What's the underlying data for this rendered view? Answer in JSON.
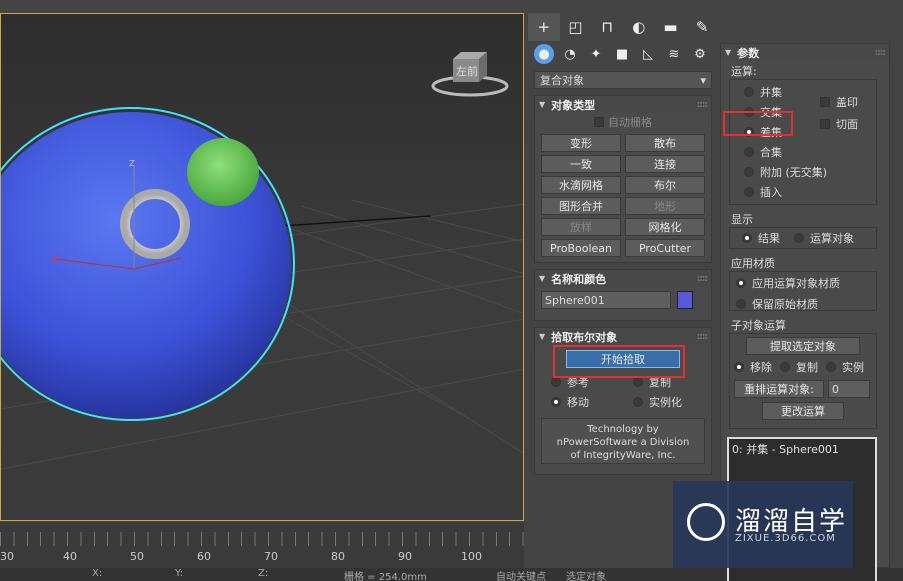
{
  "viewport": {
    "axis_labels": {
      "z": "z",
      "y": "y"
    },
    "viewcube_label": "左前"
  },
  "timeline": {
    "labels": [
      "30",
      "40",
      "50",
      "60",
      "70",
      "80",
      "90",
      "100"
    ]
  },
  "status": {
    "x_label": "X:",
    "y_label": "Y:",
    "z_label": "Z:",
    "grid": "栅格 = 254.0mm",
    "autokey": "自动关键点",
    "selected": "选定对象"
  },
  "command_panel": {
    "tabs": [
      "create-icon",
      "modify-icon",
      "hierarchy-icon",
      "motion-icon",
      "display-icon",
      "utilities-icon"
    ],
    "dropdown": {
      "value": "复合对象",
      "arrow": "▾"
    },
    "object_type": {
      "title": "对象类型",
      "autogrid": "自动栅格",
      "buttons": [
        {
          "label": "变形",
          "enabled": true
        },
        {
          "label": "散布",
          "enabled": true
        },
        {
          "label": "一致",
          "enabled": true
        },
        {
          "label": "连接",
          "enabled": true
        },
        {
          "label": "水滴网格",
          "enabled": true
        },
        {
          "label": "布尔",
          "enabled": true
        },
        {
          "label": "图形合并",
          "enabled": true
        },
        {
          "label": "地形",
          "enabled": false
        },
        {
          "label": "放样",
          "enabled": false
        },
        {
          "label": "网格化",
          "enabled": true
        },
        {
          "label": "ProBoolean",
          "enabled": true
        },
        {
          "label": "ProCutter",
          "enabled": true
        }
      ]
    },
    "name_color": {
      "title": "名称和颜色",
      "name": "Sphere001",
      "color": "#5a5ad8"
    },
    "pick_boolean": {
      "title": "拾取布尔对象",
      "start_pick": "开始拾取",
      "options": {
        "ref": "参考",
        "copy": "复制",
        "move": "移动",
        "instance": "实例化"
      },
      "credit_lines": [
        "Technology by",
        "nPowerSoftware a Division",
        "of IntegrityWare, Inc."
      ]
    }
  },
  "parameters": {
    "title": "参数",
    "operation": {
      "title": "运算:",
      "union": "并集",
      "intersect": "交集",
      "subtract": "差集",
      "merge": "合集",
      "attach": "附加 (无交集)",
      "insert": "插入",
      "imprint": "盖印",
      "cut": "切面"
    },
    "display": {
      "title": "显示",
      "result": "结果",
      "operands": "运算对象"
    },
    "apply_material": {
      "title": "应用材质",
      "operand_material": "应用运算对象材质",
      "keep_original": "保留原始材质"
    },
    "sub_object": {
      "title": "子对象运算",
      "extract": "提取选定对象",
      "remove": "移除",
      "copy": "复制",
      "instance": "实例",
      "reorder": "重排运算对象:",
      "reorder_value": "0",
      "change": "更改运算"
    },
    "list": [
      "0: 并集 - Sphere001"
    ]
  },
  "watermark": {
    "title": "溜溜自学",
    "url": "ZIXUE.3D66.COM"
  },
  "colors": {
    "viewport_border": "#c8a84a",
    "highlight": "#e03030",
    "active_tab": "#5aa0e8",
    "sphere": "#4a62e0",
    "selection": "#40e0ff"
  }
}
